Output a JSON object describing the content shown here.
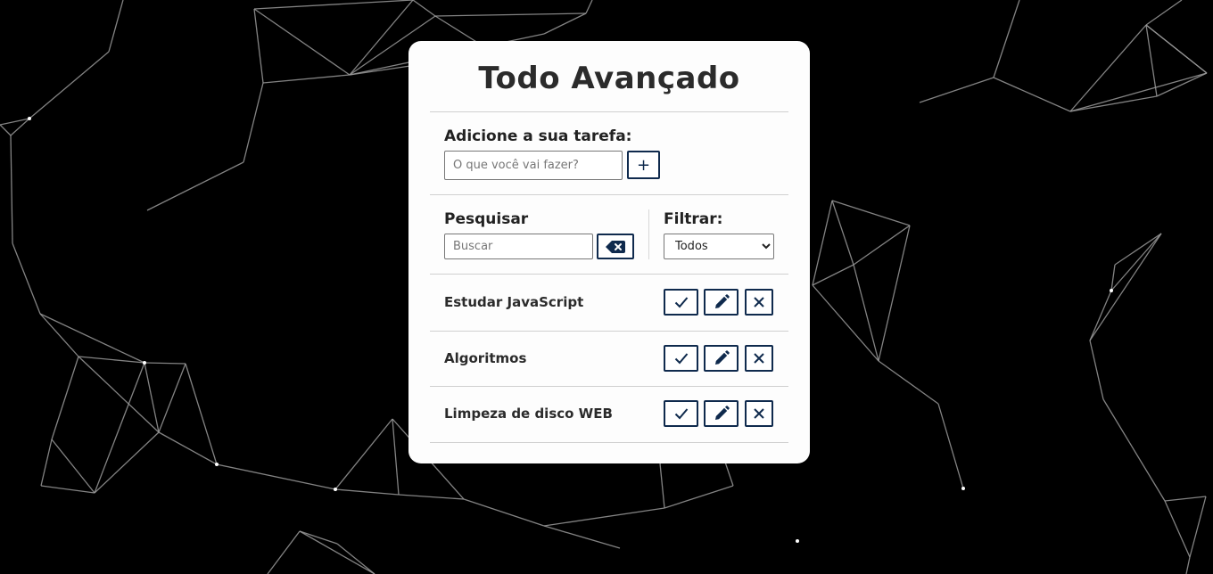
{
  "app": {
    "title": "Todo Avançado"
  },
  "add": {
    "label": "Adicione a sua tarefa:",
    "input_value": "",
    "input_placeholder": "O que você vai fazer?",
    "button_label": "+"
  },
  "search": {
    "label": "Pesquisar",
    "input_value": "",
    "input_placeholder": "Buscar",
    "clear_icon": "backspace-icon"
  },
  "filter": {
    "label": "Filtrar:",
    "selected": "Todos"
  },
  "todos": [
    {
      "text": "Estudar JavaScript"
    },
    {
      "text": "Algoritmos"
    },
    {
      "text": "Limpeza de disco WEB"
    }
  ],
  "todo_actions": {
    "done_icon": "check-icon",
    "edit_icon": "pencil-icon",
    "remove_icon": "close-icon"
  },
  "colors": {
    "page_background": "#000000",
    "card_background": "#fdfdfd",
    "accent": "#0f2a4d",
    "network_lines": "#9a9a9a"
  }
}
